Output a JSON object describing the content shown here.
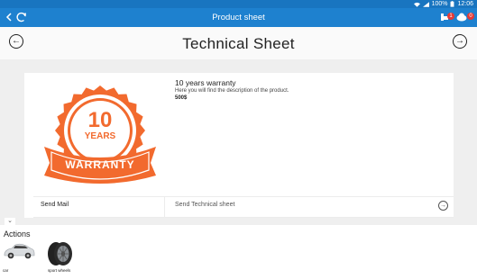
{
  "status_bar": {
    "battery": "100%",
    "time": "12:06"
  },
  "app_bar": {
    "title": "Product sheet",
    "back_icon": "arrow-back-icon",
    "refresh_icon": "refresh-icon",
    "badge_1": "1",
    "badge_2": "0"
  },
  "header": {
    "title": "Technical Sheet"
  },
  "product": {
    "name": "10 years warranty",
    "description": "Here you will find the description of the product.",
    "price": "500$",
    "badge": {
      "number": "10",
      "years": "YEARS",
      "warranty": "WARRANTY"
    }
  },
  "buttons": {
    "send_mail": "Send Mail",
    "send_technical_sheet": "Send Technical sheet"
  },
  "actions": {
    "title": "Actions",
    "items": [
      {
        "label": "car"
      },
      {
        "label": "sport wheels"
      }
    ]
  },
  "colors": {
    "statusbar": "#1975c0",
    "appbar": "#1e81cf",
    "badge_orange": "#f26a2e",
    "badge_red": "#e53935"
  }
}
